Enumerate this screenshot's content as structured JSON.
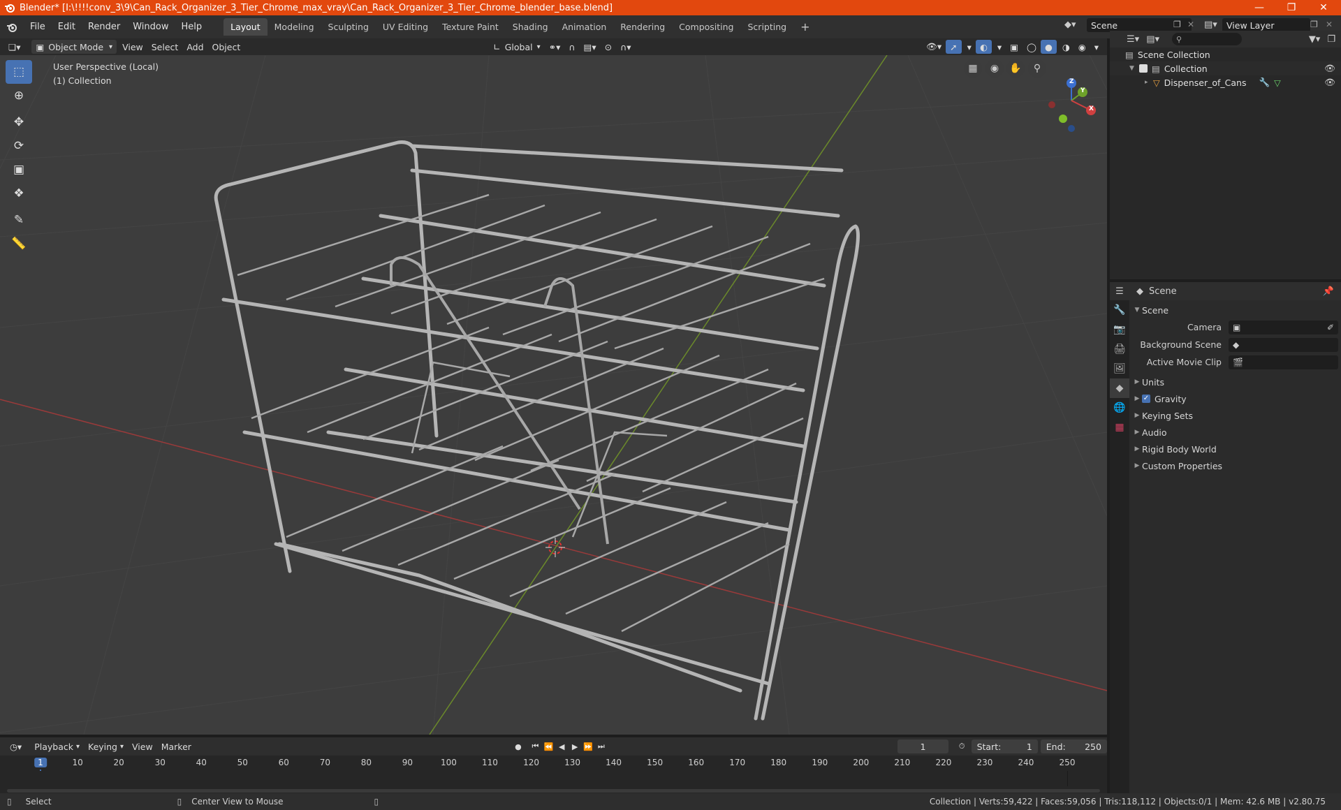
{
  "title": "Blender* [I:\\!!!!conv_3\\9\\Can_Rack_Organizer_3_Tier_Chrome_max_vray\\Can_Rack_Organizer_3_Tier_Chrome_blender_base.blend]",
  "menus": [
    "File",
    "Edit",
    "Render",
    "Window",
    "Help"
  ],
  "workspaces": [
    "Layout",
    "Modeling",
    "Sculpting",
    "UV Editing",
    "Texture Paint",
    "Shading",
    "Animation",
    "Rendering",
    "Compositing",
    "Scripting"
  ],
  "active_workspace": "Layout",
  "add_workspace": "+",
  "scene_name": "Scene",
  "view_layer": "View Layer",
  "viewport": {
    "mode": "Object Mode",
    "menus": [
      "View",
      "Select",
      "Add",
      "Object"
    ],
    "transform_orientation": "Global",
    "info_line1": "User Perspective (Local)",
    "info_line2": "(1) Collection",
    "gizmo": {
      "x": "X",
      "y": "Y",
      "z": "Z"
    }
  },
  "outliner": {
    "root": "Scene Collection",
    "collection": "Collection",
    "object": "Dispenser_of_Cans"
  },
  "properties": {
    "header": "Scene",
    "panel": "Scene",
    "fields": [
      {
        "label": "Camera",
        "value": ""
      },
      {
        "label": "Background Scene",
        "value": ""
      },
      {
        "label": "Active Movie Clip",
        "value": ""
      }
    ],
    "subpanels": [
      "Units",
      "Gravity",
      "Keying Sets",
      "Audio",
      "Rigid Body World",
      "Custom Properties"
    ]
  },
  "timeline": {
    "menus": [
      "Playback",
      "Keying",
      "View",
      "Marker"
    ],
    "current_frame": "1",
    "start_label": "Start:",
    "start": "1",
    "end_label": "End:",
    "end": "250",
    "ticks": [
      "1",
      "10",
      "20",
      "30",
      "40",
      "50",
      "60",
      "70",
      "80",
      "90",
      "100",
      "110",
      "120",
      "130",
      "140",
      "150",
      "160",
      "170",
      "180",
      "190",
      "200",
      "210",
      "220",
      "230",
      "240",
      "250"
    ]
  },
  "status": {
    "left1": "Select",
    "left2": "Center View to Mouse",
    "right": "Collection | Verts:59,422 | Faces:59,056 | Tris:118,112 | Objects:0/1 | Mem: 42.6 MB | v2.80.75"
  }
}
